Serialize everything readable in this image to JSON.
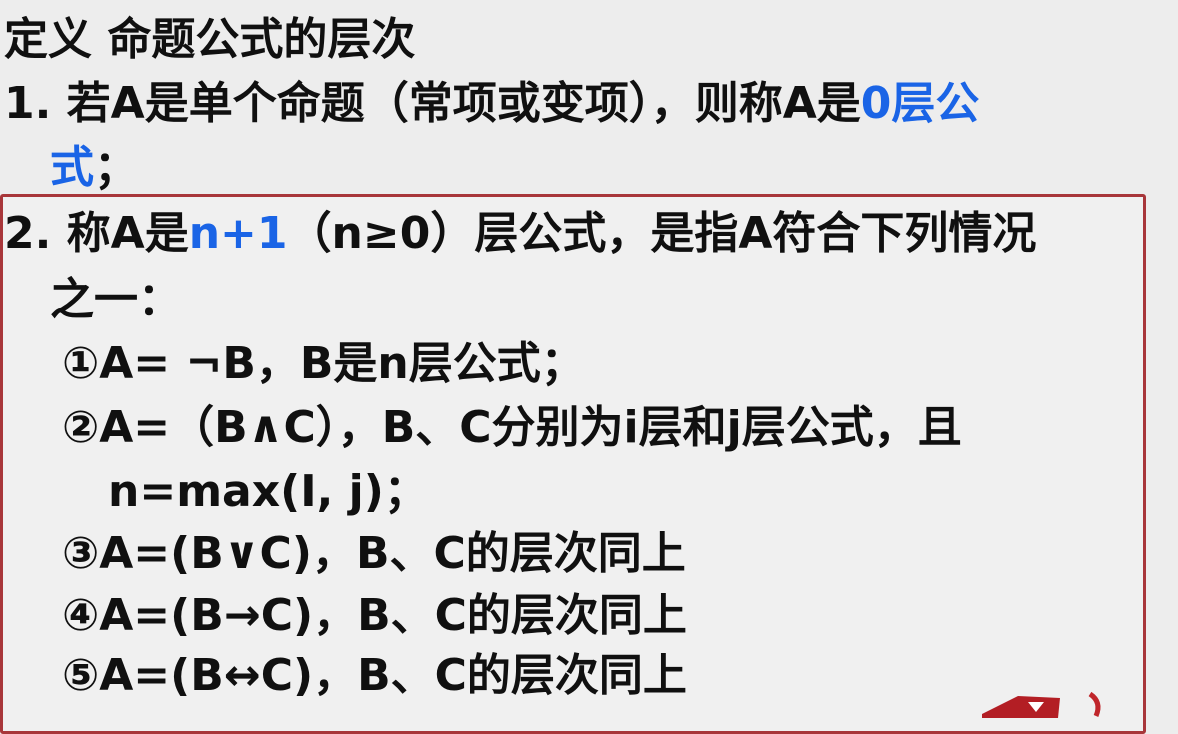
{
  "slide": {
    "title": "定义 命题公式的层次",
    "item1": {
      "prefix": "1. 若A是单个命题（常项或变项），则称A是",
      "highlight_a": "0层公",
      "highlight_b": "式",
      "suffix": "；"
    },
    "item2": {
      "prefix": "2. 称A是",
      "highlight": "n+1",
      "middle": "（n≥0）层公式，是指A符合下列情况",
      "continuation": "之一："
    },
    "cases": [
      "①A= ¬B，B是n层公式；",
      "②A=（B∧C），B、C分别为i层和j层公式，且",
      "n=max(I, j)；",
      "③A=(B∨C)，B、C的层次同上",
      "④A=(B→C)，B、C的层次同上",
      "⑤A=(B↔C)，B、C的层次同上"
    ],
    "colors": {
      "highlight": "#1a64e6",
      "frame": "#a8363a",
      "background": "#ededed",
      "text": "#101010"
    }
  }
}
